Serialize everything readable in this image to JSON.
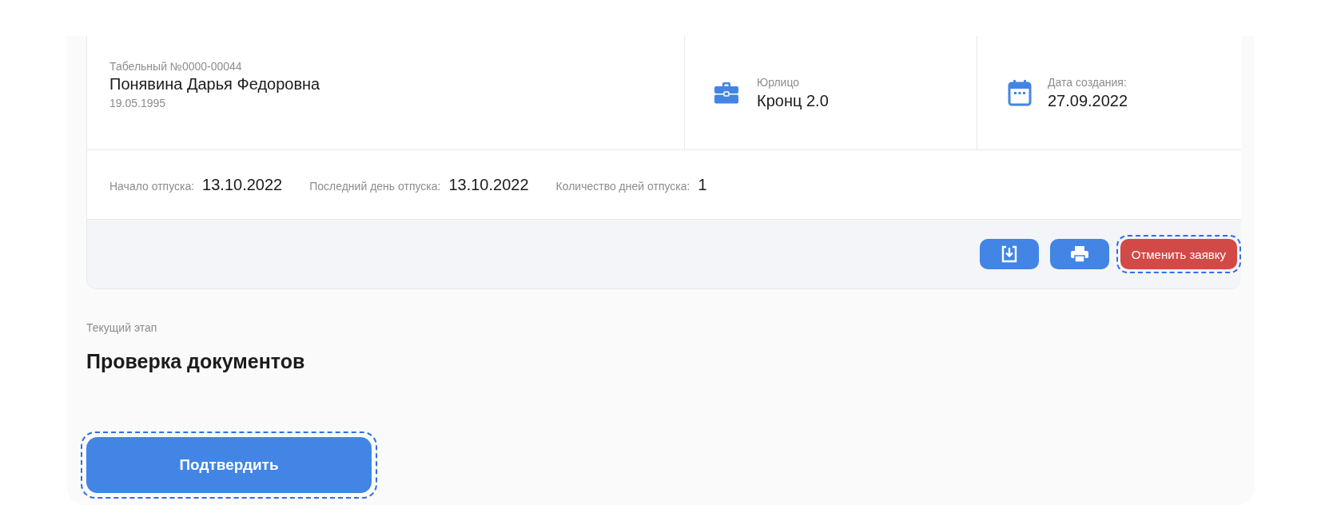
{
  "employee": {
    "number": "Табельный №0000-00044",
    "name": "Понявина Дарья Федоровна",
    "birth_date": "19.05.1995"
  },
  "info": [
    {
      "kind": "company",
      "label": "Юрлицо",
      "value": "Кронц 2.0"
    },
    {
      "kind": "date",
      "label": "Дата создания:",
      "value": "27.09.2022"
    }
  ],
  "vacation": [
    {
      "label": "Начало отпуска:",
      "value": "13.10.2022"
    },
    {
      "label": "Последний день отпуска:",
      "value": "13.10.2022"
    },
    {
      "label": "Количество дней отпуска:",
      "value": "1"
    }
  ],
  "actions": [
    {
      "kind": "download",
      "focused": false
    },
    {
      "kind": "print",
      "focused": false
    },
    {
      "kind": "cancel",
      "label": "Отменить заявку",
      "focused": true
    }
  ],
  "stage": {
    "caption": "Текущий этап",
    "title": "Проверка документов"
  },
  "confirm": {
    "label": "Подтвердить",
    "focused": true
  }
}
